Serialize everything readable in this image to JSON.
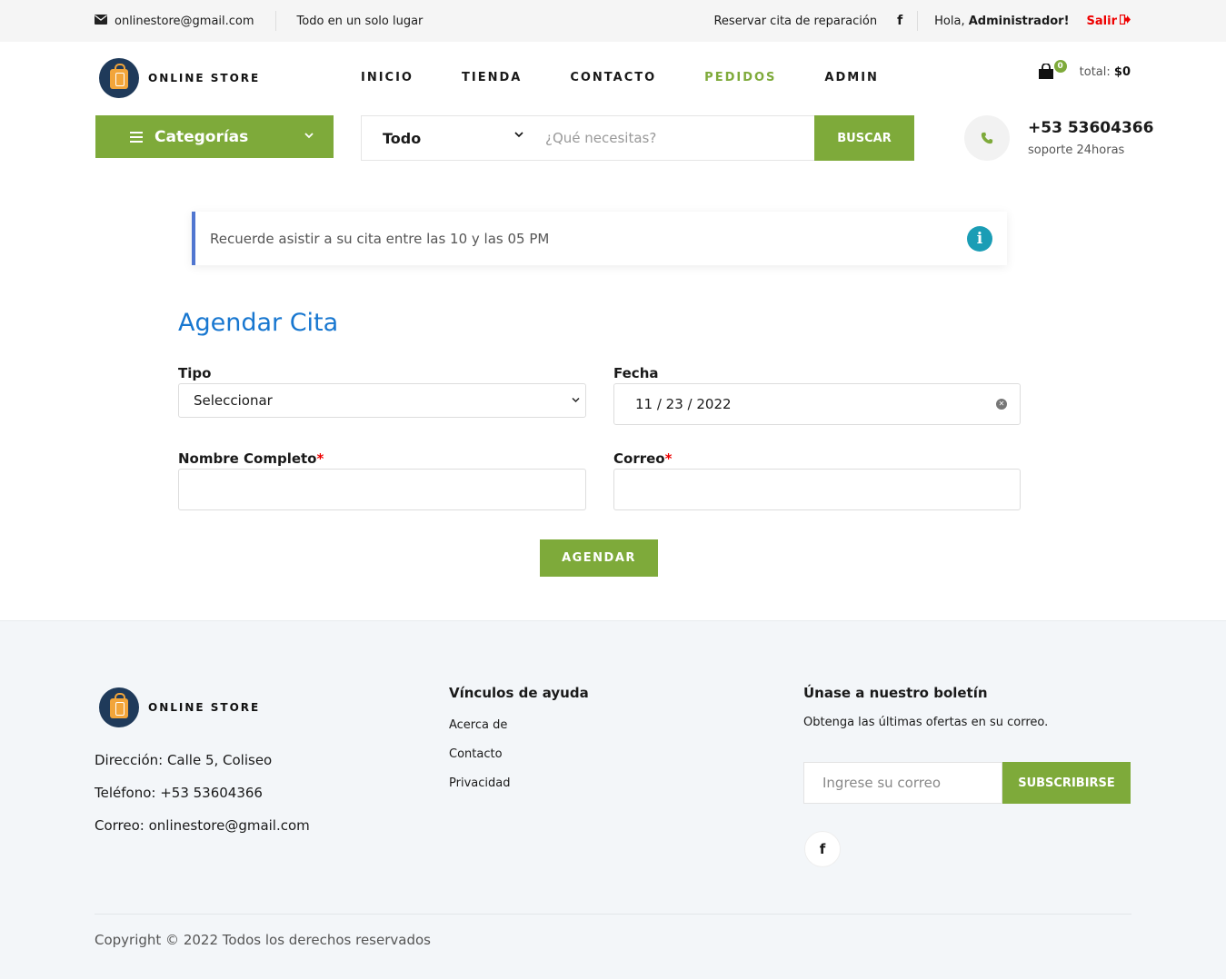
{
  "topbar": {
    "email": "onlinestore@gmail.com",
    "tagline": "Todo en un solo lugar",
    "reservar": "Reservar cita de reparación",
    "hola": "Hola, ",
    "user": "Administrador!",
    "salir": "Salir"
  },
  "logo": {
    "text": "ONLINE STORE"
  },
  "nav": [
    "INICIO",
    "TIENDA",
    "CONTACTO",
    "PEDIDOS",
    "ADMIN"
  ],
  "nav_active": "PEDIDOS",
  "cart": {
    "count": "0",
    "total_label": "total:",
    "total_value": "$0"
  },
  "categories": {
    "label": "Categorías"
  },
  "search": {
    "category": "Todo",
    "placeholder": "¿Qué necesitas?",
    "button": "BUSCAR"
  },
  "support": {
    "phone": "+53 53604366",
    "sub": "soporte 24horas"
  },
  "alert": {
    "text": "Recuerde asistir a su cita entre las 10 y las 05 PM"
  },
  "form": {
    "title": "Agendar Cita",
    "tipo_label": "Tipo",
    "tipo_value": "Seleccionar",
    "fecha_label": "Fecha",
    "fecha_value": "11 / 23 / 2022",
    "nombre_label": "Nombre Completo",
    "correo_label": "Correo",
    "required_mark": "*",
    "submit": "AGENDAR"
  },
  "footer": {
    "logo_text": "ONLINE STORE",
    "direccion": "Dirección: Calle 5, Coliseo",
    "telefono": "Teléfono: +53 53604366",
    "correo": "Correo: onlinestore@gmail.com",
    "help_title": "Vínculos de ayuda",
    "help_links": [
      "Acerca de",
      "Contacto",
      "Privacidad"
    ],
    "news_title": "Únase a nuestro boletín",
    "news_sub": "Obtenga las últimas ofertas en su correo.",
    "news_placeholder": "Ingrese su correo",
    "news_button": "SUBSCRIBIRSE",
    "copyright": "Copyright © 2022 Todos los derechos reservados"
  },
  "colors": {
    "accent": "#7eaa3a",
    "title_blue": "#1877d0",
    "alert_border": "#5076d0",
    "info_icon": "#1b9db5",
    "danger": "#ee0000"
  }
}
